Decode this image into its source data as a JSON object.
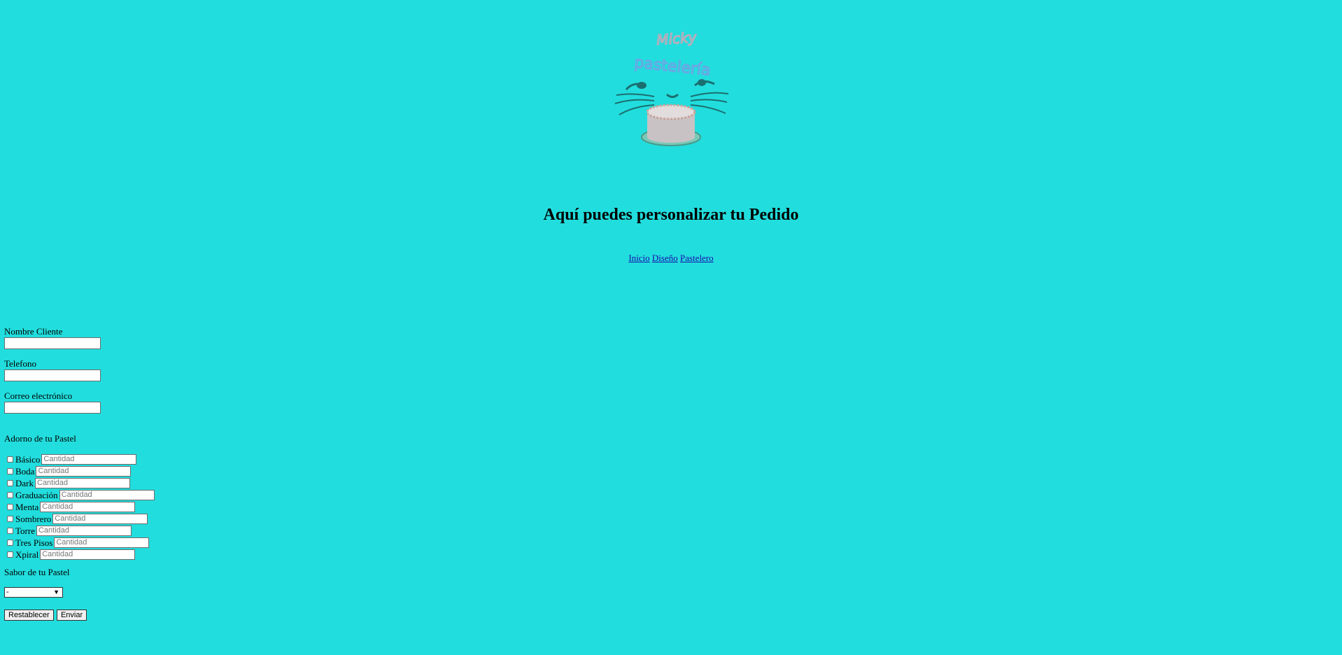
{
  "logo": {
    "text_top": "Micky",
    "text_bottom": "pastelería",
    "colors": {
      "top_text": "#d9a3b4",
      "bottom_text": "#7b9be6",
      "whiskers": "#1b6f70",
      "cake": "#c9c2c4"
    }
  },
  "page": {
    "title": "Aquí puedes personalizar tu Pedido",
    "background": "#22dddd"
  },
  "nav": {
    "links": [
      "Inicio",
      "Diseño",
      "Pastelero"
    ]
  },
  "form": {
    "nombre_label": "Nombre Cliente",
    "nombre_value": "",
    "telefono_label": "Telefono",
    "telefono_value": "",
    "correo_label": "Correo electrónico",
    "correo_value": "",
    "adorno_title": "Adorno de tu Pastel",
    "adornos": [
      {
        "label": "Básico",
        "placeholder": "Cantidad"
      },
      {
        "label": "Boda",
        "placeholder": "Cantidad"
      },
      {
        "label": "Dark",
        "placeholder": "Cantidad"
      },
      {
        "label": "Graduación",
        "placeholder": "Cantidad"
      },
      {
        "label": "Menta",
        "placeholder": "Cantidad"
      },
      {
        "label": "Sombrero",
        "placeholder": "Cantidad"
      },
      {
        "label": "Torre",
        "placeholder": "Cantidad"
      },
      {
        "label": "Tres Pisos",
        "placeholder": "Cantidad"
      },
      {
        "label": "Xpiral",
        "placeholder": "Cantidad"
      }
    ],
    "sabor_title": "Sabor de tu Pastel",
    "sabor_selected": "-",
    "reset_label": "Restablecer",
    "submit_label": "Enviar"
  }
}
